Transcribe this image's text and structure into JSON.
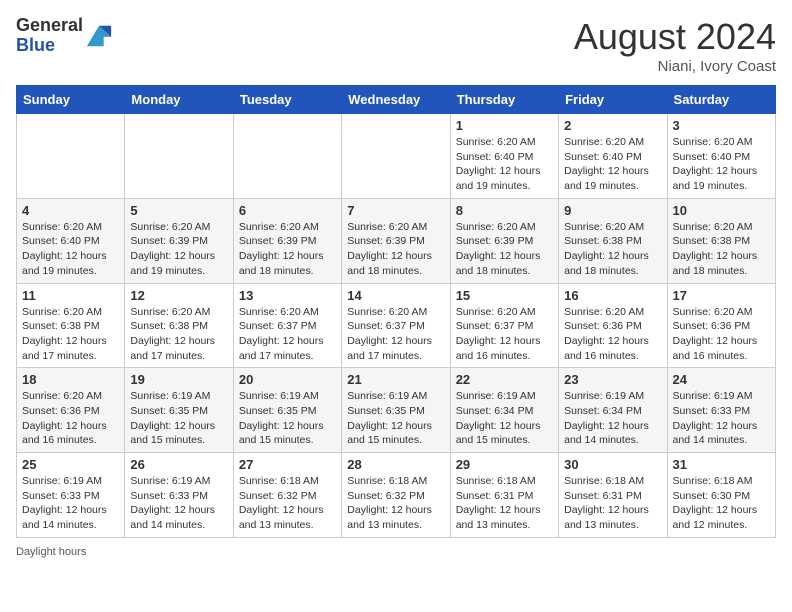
{
  "header": {
    "logo_line1": "General",
    "logo_line2": "Blue",
    "month_year": "August 2024",
    "location": "Niani, Ivory Coast"
  },
  "days_of_week": [
    "Sunday",
    "Monday",
    "Tuesday",
    "Wednesday",
    "Thursday",
    "Friday",
    "Saturday"
  ],
  "weeks": [
    [
      {
        "day": "",
        "info": ""
      },
      {
        "day": "",
        "info": ""
      },
      {
        "day": "",
        "info": ""
      },
      {
        "day": "",
        "info": ""
      },
      {
        "day": "1",
        "info": "Sunrise: 6:20 AM\nSunset: 6:40 PM\nDaylight: 12 hours\nand 19 minutes."
      },
      {
        "day": "2",
        "info": "Sunrise: 6:20 AM\nSunset: 6:40 PM\nDaylight: 12 hours\nand 19 minutes."
      },
      {
        "day": "3",
        "info": "Sunrise: 6:20 AM\nSunset: 6:40 PM\nDaylight: 12 hours\nand 19 minutes."
      }
    ],
    [
      {
        "day": "4",
        "info": "Sunrise: 6:20 AM\nSunset: 6:40 PM\nDaylight: 12 hours\nand 19 minutes."
      },
      {
        "day": "5",
        "info": "Sunrise: 6:20 AM\nSunset: 6:39 PM\nDaylight: 12 hours\nand 19 minutes."
      },
      {
        "day": "6",
        "info": "Sunrise: 6:20 AM\nSunset: 6:39 PM\nDaylight: 12 hours\nand 18 minutes."
      },
      {
        "day": "7",
        "info": "Sunrise: 6:20 AM\nSunset: 6:39 PM\nDaylight: 12 hours\nand 18 minutes."
      },
      {
        "day": "8",
        "info": "Sunrise: 6:20 AM\nSunset: 6:39 PM\nDaylight: 12 hours\nand 18 minutes."
      },
      {
        "day": "9",
        "info": "Sunrise: 6:20 AM\nSunset: 6:38 PM\nDaylight: 12 hours\nand 18 minutes."
      },
      {
        "day": "10",
        "info": "Sunrise: 6:20 AM\nSunset: 6:38 PM\nDaylight: 12 hours\nand 18 minutes."
      }
    ],
    [
      {
        "day": "11",
        "info": "Sunrise: 6:20 AM\nSunset: 6:38 PM\nDaylight: 12 hours\nand 17 minutes."
      },
      {
        "day": "12",
        "info": "Sunrise: 6:20 AM\nSunset: 6:38 PM\nDaylight: 12 hours\nand 17 minutes."
      },
      {
        "day": "13",
        "info": "Sunrise: 6:20 AM\nSunset: 6:37 PM\nDaylight: 12 hours\nand 17 minutes."
      },
      {
        "day": "14",
        "info": "Sunrise: 6:20 AM\nSunset: 6:37 PM\nDaylight: 12 hours\nand 17 minutes."
      },
      {
        "day": "15",
        "info": "Sunrise: 6:20 AM\nSunset: 6:37 PM\nDaylight: 12 hours\nand 16 minutes."
      },
      {
        "day": "16",
        "info": "Sunrise: 6:20 AM\nSunset: 6:36 PM\nDaylight: 12 hours\nand 16 minutes."
      },
      {
        "day": "17",
        "info": "Sunrise: 6:20 AM\nSunset: 6:36 PM\nDaylight: 12 hours\nand 16 minutes."
      }
    ],
    [
      {
        "day": "18",
        "info": "Sunrise: 6:20 AM\nSunset: 6:36 PM\nDaylight: 12 hours\nand 16 minutes."
      },
      {
        "day": "19",
        "info": "Sunrise: 6:19 AM\nSunset: 6:35 PM\nDaylight: 12 hours\nand 15 minutes."
      },
      {
        "day": "20",
        "info": "Sunrise: 6:19 AM\nSunset: 6:35 PM\nDaylight: 12 hours\nand 15 minutes."
      },
      {
        "day": "21",
        "info": "Sunrise: 6:19 AM\nSunset: 6:35 PM\nDaylight: 12 hours\nand 15 minutes."
      },
      {
        "day": "22",
        "info": "Sunrise: 6:19 AM\nSunset: 6:34 PM\nDaylight: 12 hours\nand 15 minutes."
      },
      {
        "day": "23",
        "info": "Sunrise: 6:19 AM\nSunset: 6:34 PM\nDaylight: 12 hours\nand 14 minutes."
      },
      {
        "day": "24",
        "info": "Sunrise: 6:19 AM\nSunset: 6:33 PM\nDaylight: 12 hours\nand 14 minutes."
      }
    ],
    [
      {
        "day": "25",
        "info": "Sunrise: 6:19 AM\nSunset: 6:33 PM\nDaylight: 12 hours\nand 14 minutes."
      },
      {
        "day": "26",
        "info": "Sunrise: 6:19 AM\nSunset: 6:33 PM\nDaylight: 12 hours\nand 14 minutes."
      },
      {
        "day": "27",
        "info": "Sunrise: 6:18 AM\nSunset: 6:32 PM\nDaylight: 12 hours\nand 13 minutes."
      },
      {
        "day": "28",
        "info": "Sunrise: 6:18 AM\nSunset: 6:32 PM\nDaylight: 12 hours\nand 13 minutes."
      },
      {
        "day": "29",
        "info": "Sunrise: 6:18 AM\nSunset: 6:31 PM\nDaylight: 12 hours\nand 13 minutes."
      },
      {
        "day": "30",
        "info": "Sunrise: 6:18 AM\nSunset: 6:31 PM\nDaylight: 12 hours\nand 13 minutes."
      },
      {
        "day": "31",
        "info": "Sunrise: 6:18 AM\nSunset: 6:30 PM\nDaylight: 12 hours\nand 12 minutes."
      }
    ]
  ],
  "footer": {
    "daylight_label": "Daylight hours"
  }
}
